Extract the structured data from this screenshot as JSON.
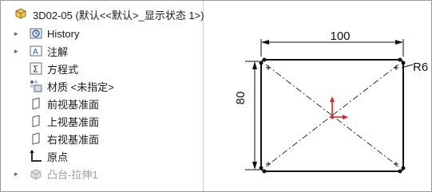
{
  "tree": {
    "root_label": "3D02-05  (默认<<默认>_显示状态 1>)",
    "items": [
      {
        "label": "History",
        "icon": "history-icon",
        "expandable": true
      },
      {
        "label": "注解",
        "icon": "annotation-icon",
        "expandable": true
      },
      {
        "label": "方程式",
        "icon": "equation-icon",
        "expandable": false
      },
      {
        "label": "材质 <未指定>",
        "icon": "material-icon",
        "expandable": false
      },
      {
        "label": "前视基准面",
        "icon": "plane-icon",
        "expandable": false
      },
      {
        "label": "上视基准面",
        "icon": "plane-icon",
        "expandable": false
      },
      {
        "label": "右视基准面",
        "icon": "plane-icon",
        "expandable": false
      },
      {
        "label": "原点",
        "icon": "origin-icon",
        "expandable": false
      },
      {
        "label": "凸台-拉伸1",
        "icon": "extrude-icon",
        "expandable": true
      }
    ]
  },
  "sketch": {
    "dim_horizontal": "100",
    "dim_vertical": "80",
    "radius_label": "R6"
  },
  "colors": {
    "accent_red": "#e02020",
    "line": "#111111"
  }
}
